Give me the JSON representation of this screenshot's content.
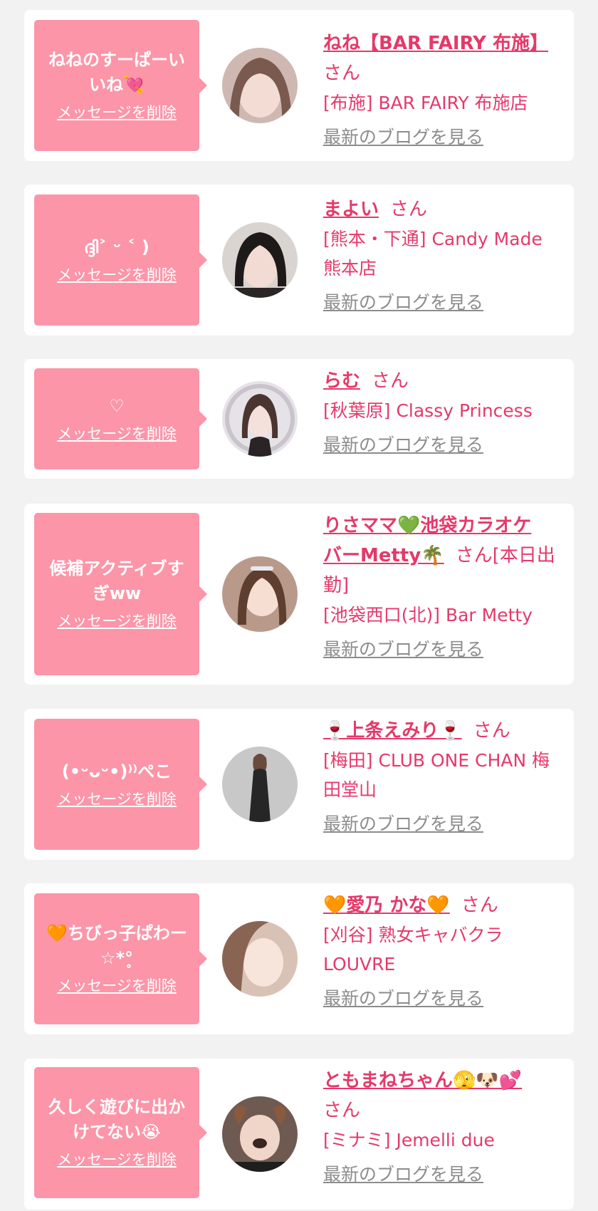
{
  "delete_label": "メッセージを削除",
  "blog_label": "最新のブログを見る",
  "san_label": "さん",
  "colors": {
    "bubble": "#fc95a8",
    "name": "#e5396a",
    "link_gray": "#8c8c8c",
    "background": "#f2f2f2"
  },
  "items": [
    {
      "message": "ねねのすーぱーいいね💘",
      "name_parts": [
        "ねね【BAR FAIRY 布施】"
      ],
      "suffix_parts": [
        "さん"
      ],
      "shop_lines": [
        "[布施] BAR FAIRY 布施店"
      ]
    },
    {
      "message": "ദ്ദി˃ ᵕ ˂ )",
      "name_parts": [
        "まよい"
      ],
      "suffix_parts": [
        "さん"
      ],
      "shop_lines": [
        "[熊本・下通] Candy Made",
        "熊本店"
      ]
    },
    {
      "message": "♡",
      "name_parts": [
        "らむ"
      ],
      "suffix_parts": [
        "さん"
      ],
      "shop_lines": [
        "[秋葉原] Classy Princess"
      ]
    },
    {
      "message": "候補アクティブすぎww",
      "name_parts": [
        "りさママ💚池袋カラオケ",
        "バーMetty🌴"
      ],
      "suffix_parts": [
        "さん[本日出",
        "勤]"
      ],
      "shop_lines": [
        "[池袋西口(北)] Bar Metty"
      ]
    },
    {
      "message": "(•ᵕᴗᵕ•)⁾⁾ぺこ",
      "name_parts": [
        "🍷上条えみり🍷"
      ],
      "suffix_parts": [
        "さん"
      ],
      "shop_lines": [
        "[梅田] CLUB ONE CHAN 梅",
        "田堂山"
      ]
    },
    {
      "message": "🧡ちびっ子ぱわー☆*°̥",
      "name_parts": [
        "🧡愛乃 かな🧡"
      ],
      "suffix_parts": [
        "さん"
      ],
      "shop_lines": [
        "[刈谷] 熟女キャバクラ",
        "LOUVRE"
      ]
    },
    {
      "message": "久しく遊びに出かけてない😭",
      "name_parts": [
        "ともまねちゃん🫣🐶💕"
      ],
      "suffix_parts": [
        "さん"
      ],
      "shop_lines": [
        "[ミナミ] Jemelli due"
      ]
    }
  ]
}
